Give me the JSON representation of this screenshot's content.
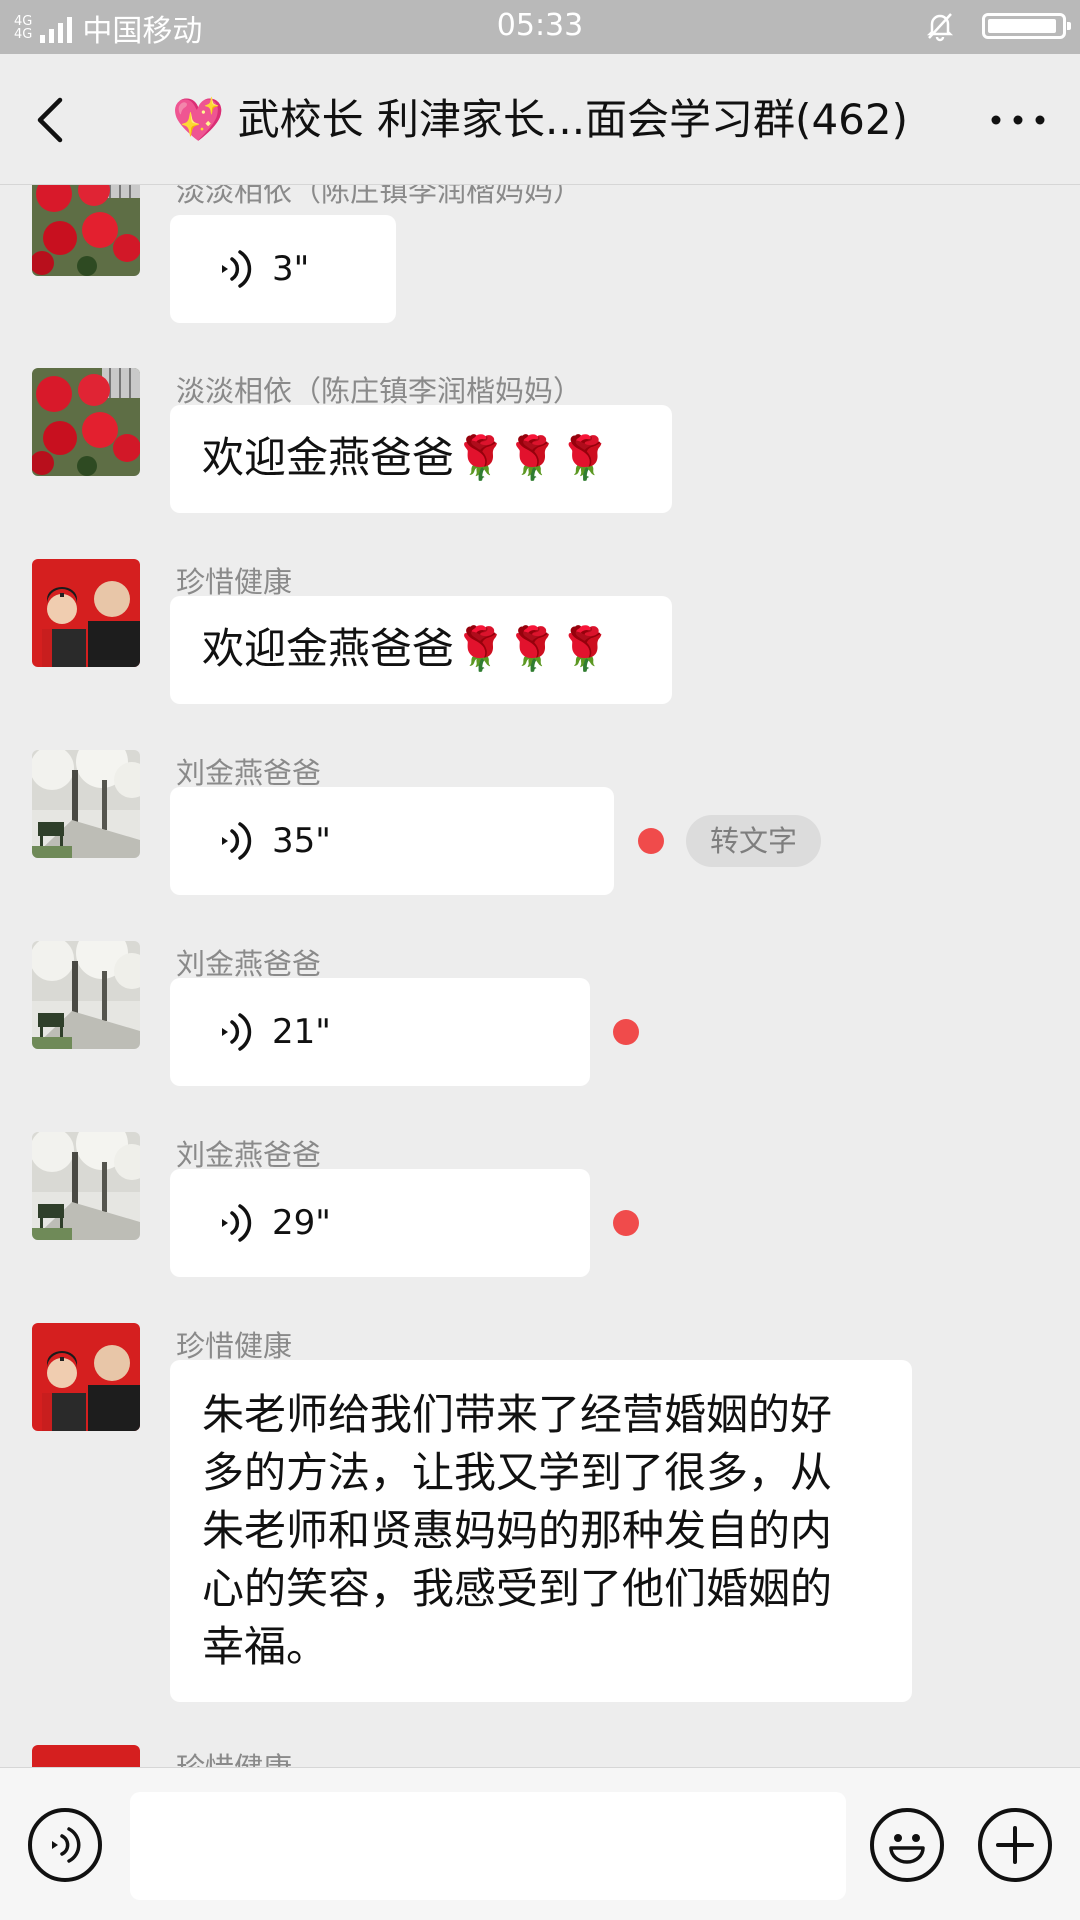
{
  "status_bar": {
    "network_top": "4G",
    "network_bottom": "4G",
    "carrier": "中国移动",
    "time": "05:33",
    "battery_level": 0.95
  },
  "header": {
    "emoji": "💖",
    "title": "武校长 利津家长...面会学习群(462)"
  },
  "messages": [
    {
      "sender": "淡淡相依（陈庄镇李润楷妈妈）",
      "type": "voice",
      "duration": "3\"",
      "avatar": "red-roses"
    },
    {
      "sender": "淡淡相依（陈庄镇李润楷妈妈）",
      "type": "text",
      "text": "欢迎金燕爸爸🌹🌹🌹",
      "avatar": "red-roses"
    },
    {
      "sender": "珍惜健康",
      "type": "text",
      "text": "欢迎金燕爸爸🌹🌹🌹",
      "avatar": "father-son-photo"
    },
    {
      "sender": "刘金燕爸爸",
      "type": "voice",
      "duration": "35\"",
      "unread": true,
      "action": "转文字",
      "avatar": "cherry-blossom-path"
    },
    {
      "sender": "刘金燕爸爸",
      "type": "voice",
      "duration": "21\"",
      "unread": true,
      "avatar": "cherry-blossom-path"
    },
    {
      "sender": "刘金燕爸爸",
      "type": "voice",
      "duration": "29\"",
      "unread": true,
      "avatar": "cherry-blossom-path"
    },
    {
      "sender": "珍惜健康",
      "type": "text",
      "lines": [
        "朱老师给我们带来了经营婚姻的好",
        "多的方法，让我又学到了很多，从",
        "朱老师和贤惠妈妈的那种发自的内",
        "心的笑容，我感受到了他们婚姻的",
        "幸福。"
      ],
      "avatar": "father-son-photo"
    },
    {
      "sender": "珍惜健康",
      "type": "partial",
      "avatar": "father-son-photo"
    }
  ],
  "input": {
    "value": "",
    "placeholder": ""
  },
  "colors": {
    "background": "#EDEDED",
    "bubble": "#FFFFFF",
    "unread_dot": "#F04B4B",
    "statusbar": "#B9B9B9"
  }
}
